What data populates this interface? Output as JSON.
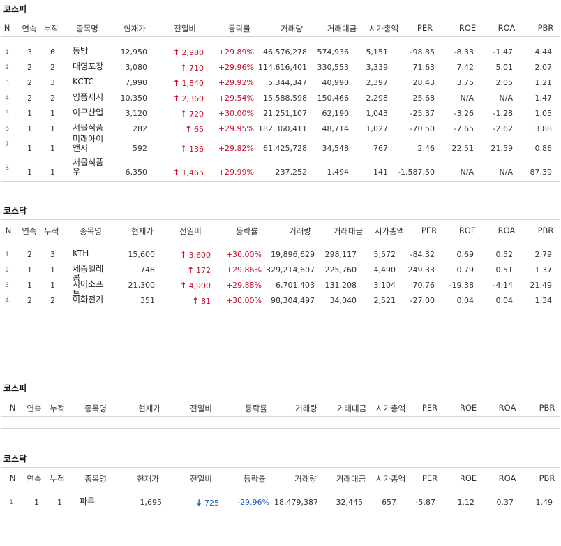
{
  "sections": [
    {
      "title": "코스피",
      "headers": [
        "N",
        "연속",
        "누적",
        "종목명",
        "현재가",
        "전일비",
        "등락률",
        "거래량",
        "거래대금",
        "시가총액",
        "PER",
        "ROE",
        "ROA",
        "PBR"
      ],
      "rows": [
        {
          "n": "1",
          "streak": "3",
          "cum": "6",
          "name": "동방",
          "price": "12,950",
          "dir": "up",
          "change": "2,980",
          "rate": "+29.89%",
          "volume": "46,576,278",
          "amount": "574,936",
          "mcap": "5,151",
          "per": "-98.85",
          "roe": "-8.33",
          "roa": "-1.47",
          "pbr": "4.44"
        },
        {
          "n": "2",
          "streak": "2",
          "cum": "2",
          "name": "대영포장",
          "price": "3,080",
          "dir": "up",
          "change": "710",
          "rate": "+29.96%",
          "volume": "114,616,401",
          "amount": "330,553",
          "mcap": "3,339",
          "per": "71.63",
          "roe": "7.42",
          "roa": "5.01",
          "pbr": "2.07"
        },
        {
          "n": "3",
          "streak": "2",
          "cum": "3",
          "name": "KCTC",
          "price": "7,990",
          "dir": "up",
          "change": "1,840",
          "rate": "+29.92%",
          "volume": "5,344,347",
          "amount": "40,990",
          "mcap": "2,397",
          "per": "28.43",
          "roe": "3.75",
          "roa": "2.05",
          "pbr": "1.21"
        },
        {
          "n": "4",
          "streak": "2",
          "cum": "2",
          "name": "영풍제지",
          "price": "10,350",
          "dir": "up",
          "change": "2,360",
          "rate": "+29.54%",
          "volume": "15,588,598",
          "amount": "150,466",
          "mcap": "2,298",
          "per": "25.68",
          "roe": "N/A",
          "roa": "N/A",
          "pbr": "1.47"
        },
        {
          "n": "5",
          "streak": "1",
          "cum": "1",
          "name": "이구산업",
          "price": "3,120",
          "dir": "up",
          "change": "720",
          "rate": "+30.00%",
          "volume": "21,251,107",
          "amount": "62,190",
          "mcap": "1,043",
          "per": "-25.37",
          "roe": "-3.26",
          "roa": "-1.28",
          "pbr": "1.05"
        },
        {
          "n": "6",
          "streak": "1",
          "cum": "1",
          "name": "서울식품",
          "price": "282",
          "dir": "up",
          "change": "65",
          "rate": "+29.95%",
          "volume": "182,360,411",
          "amount": "48,714",
          "mcap": "1,027",
          "per": "-70.50",
          "roe": "-7.65",
          "roa": "-2.62",
          "pbr": "3.88"
        },
        {
          "n": "7",
          "streak": "1",
          "cum": "1",
          "name": "미래아이앤지",
          "price": "592",
          "dir": "up",
          "change": "136",
          "rate": "+29.82%",
          "volume": "61,425,728",
          "amount": "34,548",
          "mcap": "767",
          "per": "2.46",
          "roe": "22.51",
          "roa": "21.59",
          "pbr": "0.86"
        },
        {
          "n": "8",
          "streak": "1",
          "cum": "1",
          "name": "서울식품우",
          "price": "6,350",
          "dir": "up",
          "change": "1,465",
          "rate": "+29.99%",
          "volume": "237,252",
          "amount": "1,494",
          "mcap": "141",
          "per": "-1,587.50",
          "roe": "N/A",
          "roa": "N/A",
          "pbr": "87.39"
        }
      ]
    },
    {
      "title": "코스닥",
      "headers": [
        "N",
        "연속",
        "누적",
        "종목명",
        "현재가",
        "전일비",
        "등락률",
        "거래량",
        "거래대금",
        "시가총액",
        "PER",
        "ROE",
        "ROA",
        "PBR"
      ],
      "rows": [
        {
          "n": "1",
          "streak": "2",
          "cum": "3",
          "name": "KTH",
          "price": "15,600",
          "dir": "up",
          "change": "3,600",
          "rate": "+30.00%",
          "volume": "19,896,629",
          "amount": "298,117",
          "mcap": "5,572",
          "per": "-84.32",
          "roe": "0.69",
          "roa": "0.52",
          "pbr": "2.79"
        },
        {
          "n": "2",
          "streak": "1",
          "cum": "1",
          "name": "세종텔레콤",
          "price": "748",
          "dir": "up",
          "change": "172",
          "rate": "+29.86%",
          "volume": "329,214,607",
          "amount": "225,760",
          "mcap": "4,490",
          "per": "249.33",
          "roe": "0.79",
          "roa": "0.51",
          "pbr": "1.37"
        },
        {
          "n": "3",
          "streak": "1",
          "cum": "1",
          "name": "지어소프트",
          "price": "21,300",
          "dir": "up",
          "change": "4,900",
          "rate": "+29.88%",
          "volume": "6,701,403",
          "amount": "131,208",
          "mcap": "3,104",
          "per": "70.76",
          "roe": "-19.38",
          "roa": "-4.14",
          "pbr": "21.49"
        },
        {
          "n": "4",
          "streak": "2",
          "cum": "2",
          "name": "이화전기",
          "price": "351",
          "dir": "up",
          "change": "81",
          "rate": "+30.00%",
          "volume": "98,304,497",
          "amount": "34,040",
          "mcap": "2,521",
          "per": "-27.00",
          "roe": "0.04",
          "roa": "0.04",
          "pbr": "1.34"
        }
      ]
    },
    {
      "title": "코스피",
      "headers": [
        "N",
        "연속",
        "누적",
        "종목명",
        "현재가",
        "전일비",
        "등락률",
        "거래량",
        "거래대금",
        "시가총액",
        "PER",
        "ROE",
        "ROA",
        "PBR"
      ],
      "rows": []
    },
    {
      "title": "코스닥",
      "headers": [
        "N",
        "연속",
        "누적",
        "종목명",
        "현재가",
        "전일비",
        "등락률",
        "거래량",
        "거래대금",
        "시가총액",
        "PER",
        "ROE",
        "ROA",
        "PBR"
      ],
      "rows": [
        {
          "n": "1",
          "streak": "1",
          "cum": "1",
          "name": "파루",
          "price": "1,695",
          "dir": "down",
          "change": "725",
          "rate": "-29.96%",
          "volume": "18,479,387",
          "amount": "32,445",
          "mcap": "657",
          "per": "-5.87",
          "roe": "1.12",
          "roa": "0.37",
          "pbr": "1.49"
        }
      ]
    }
  ],
  "colors": {
    "up": "#c8102e",
    "down": "#1a5ec4",
    "border": "#d6d6d6"
  },
  "icons": {
    "up": "arrow-up-icon",
    "down": "arrow-down-icon"
  }
}
